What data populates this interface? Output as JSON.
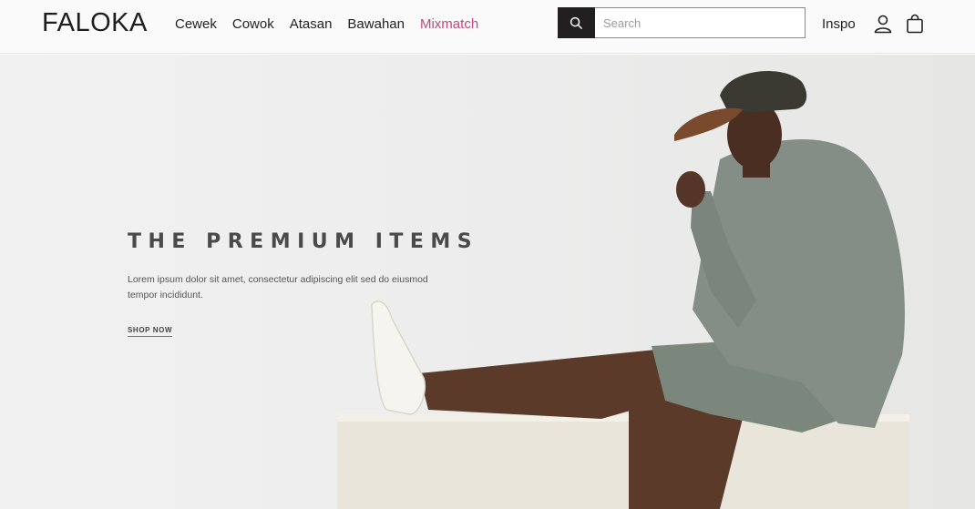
{
  "header": {
    "logo": "FALOKA",
    "nav": [
      {
        "label": "Cewek"
      },
      {
        "label": "Cowok"
      },
      {
        "label": "Atasan"
      },
      {
        "label": "Bawahan"
      },
      {
        "label": "Mixmatch"
      }
    ],
    "search": {
      "placeholder": "Search",
      "value": ""
    },
    "inspo": "Inspo",
    "icons": [
      "search-icon",
      "user-icon",
      "shopping-bag-icon"
    ]
  },
  "hero": {
    "title": "THE PREMIUM ITEMS",
    "text": "Lorem ipsum dolor sit amet, consectetur adipiscing elit sed do eiusmod tempor incididunt.",
    "cta": "SHOP NOW"
  },
  "colors": {
    "accent": "#c0487a",
    "search_button": "#231f20",
    "hero_bg": "#efefef"
  }
}
